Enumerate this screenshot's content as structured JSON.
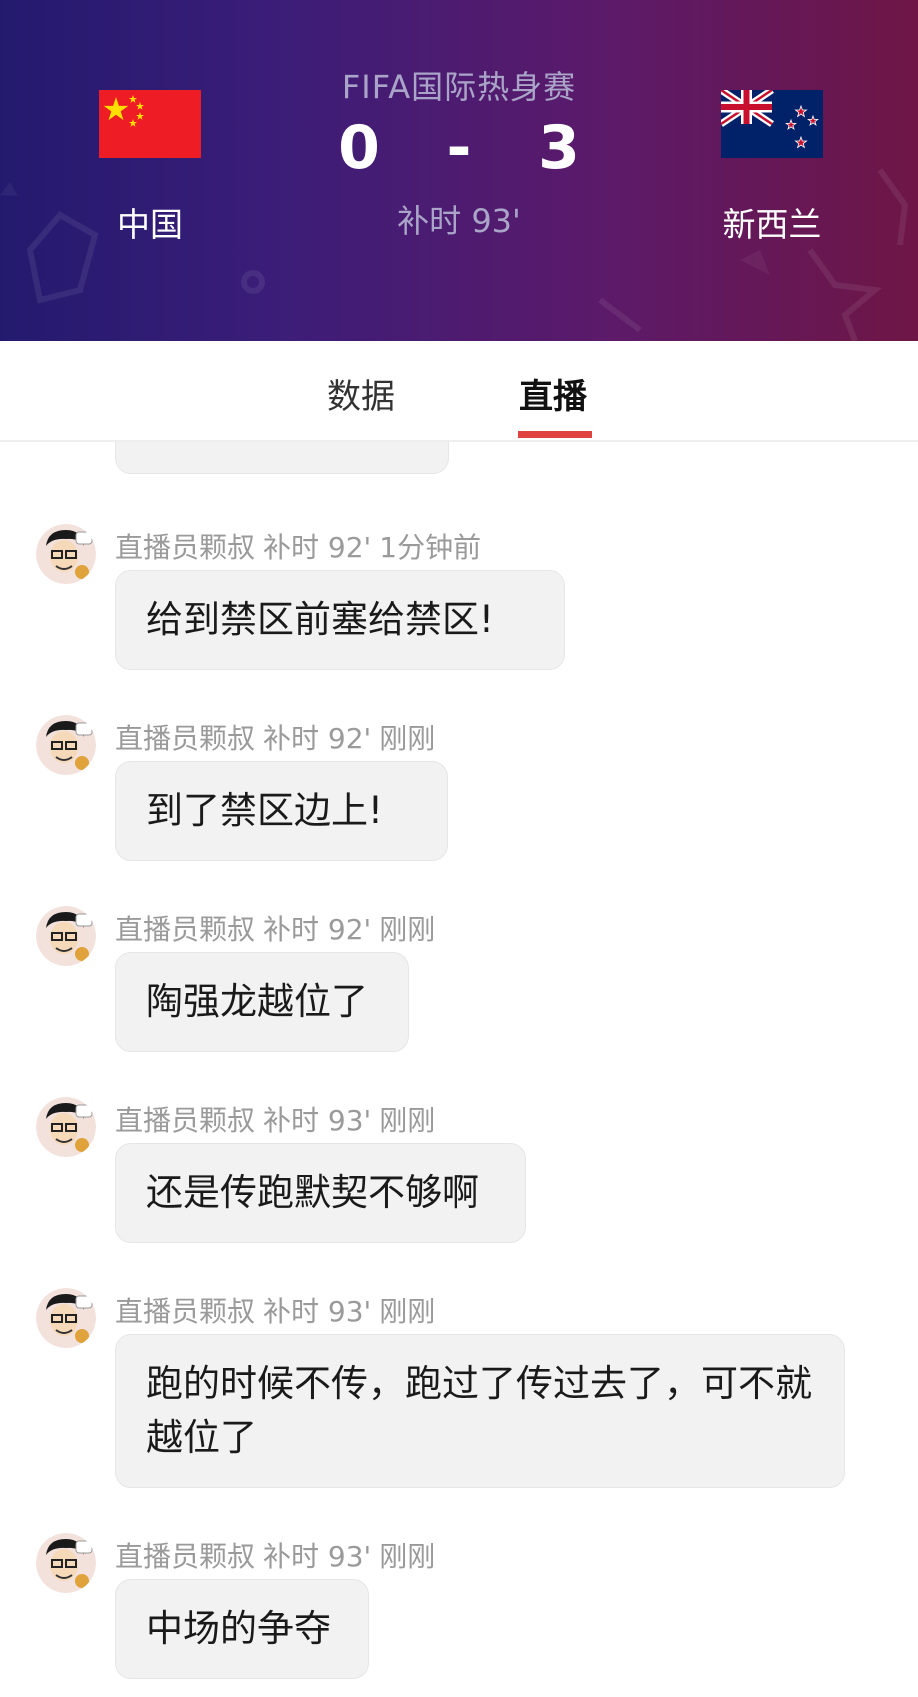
{
  "match": {
    "competition": "FIFA国际热身赛",
    "home_team": "中国",
    "away_team": "新西兰",
    "home_score": "0",
    "separator": "-",
    "away_score": "3",
    "match_time": "补时 93'"
  },
  "colors": {
    "header_gradient_start": "#231a6e",
    "header_gradient_end": "#6e1646",
    "tab_active_underline": "#e04141",
    "bubble_background": "#f2f2f2"
  },
  "tabs": [
    {
      "label": "数据",
      "active": false
    },
    {
      "label": "直播",
      "active": true
    }
  ],
  "feed": {
    "entries": [
      {
        "author": "直播员颗叔",
        "minute": "补时 92'",
        "time_ago": "1分钟前",
        "message": "给到禁区前塞给禁区!"
      },
      {
        "author": "直播员颗叔",
        "minute": "补时 92'",
        "time_ago": "刚刚",
        "message": "到了禁区边上!"
      },
      {
        "author": "直播员颗叔",
        "minute": "补时 92'",
        "time_ago": "刚刚",
        "message": "陶强龙越位了"
      },
      {
        "author": "直播员颗叔",
        "minute": "补时 93'",
        "time_ago": "刚刚",
        "message": "还是传跑默契不够啊"
      },
      {
        "author": "直播员颗叔",
        "minute": "补时 93'",
        "time_ago": "刚刚",
        "message": "跑的时候不传，跑过了传过去了，可不就越位了"
      },
      {
        "author": "直播员颗叔",
        "minute": "补时 93'",
        "time_ago": "刚刚",
        "message": "中场的争夺"
      }
    ]
  }
}
